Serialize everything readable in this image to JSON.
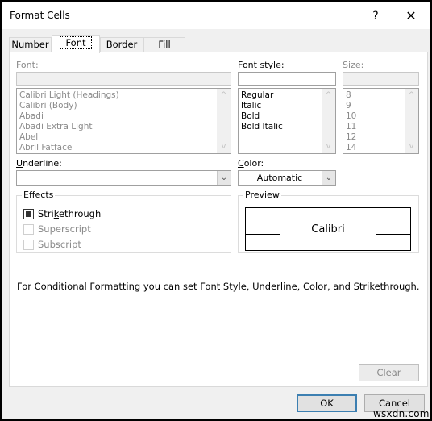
{
  "window": {
    "title": "Format Cells",
    "help_label": "?",
    "close_label": "✕"
  },
  "tabs": [
    {
      "label": "Number",
      "active": false
    },
    {
      "label": "Font",
      "active": true
    },
    {
      "label": "Border",
      "active": false
    },
    {
      "label": "Fill",
      "active": false
    }
  ],
  "font": {
    "label": "Font:",
    "value": "",
    "items": [
      "Calibri Light (Headings)",
      "Calibri (Body)",
      "Abadi",
      "Abadi Extra Light",
      "Abel",
      "Abril Fatface"
    ]
  },
  "font_style": {
    "label": "Font style:",
    "value": "",
    "items": [
      "Regular",
      "Italic",
      "Bold",
      "Bold Italic"
    ]
  },
  "size": {
    "label": "Size:",
    "value": "",
    "items": [
      "8",
      "9",
      "10",
      "11",
      "12",
      "14"
    ]
  },
  "underline": {
    "label": "Underline:",
    "value": ""
  },
  "color": {
    "label": "Color:",
    "value": "Automatic"
  },
  "effects": {
    "legend": "Effects",
    "options": [
      {
        "label": "Strikethrough",
        "checked": true,
        "enabled": true
      },
      {
        "label": "Superscript",
        "checked": false,
        "enabled": false
      },
      {
        "label": "Subscript",
        "checked": false,
        "enabled": false
      }
    ]
  },
  "preview": {
    "legend": "Preview",
    "text": "Calibri"
  },
  "info_text": "For Conditional Formatting you can set Font Style, Underline, Color, and Strikethrough.",
  "buttons": {
    "clear": "Clear",
    "ok": "OK",
    "cancel": "Cancel"
  },
  "watermark": "wsxdn.com",
  "icons": {
    "scroll_up": "^",
    "scroll_down": "v",
    "dropdown": "⌄"
  }
}
